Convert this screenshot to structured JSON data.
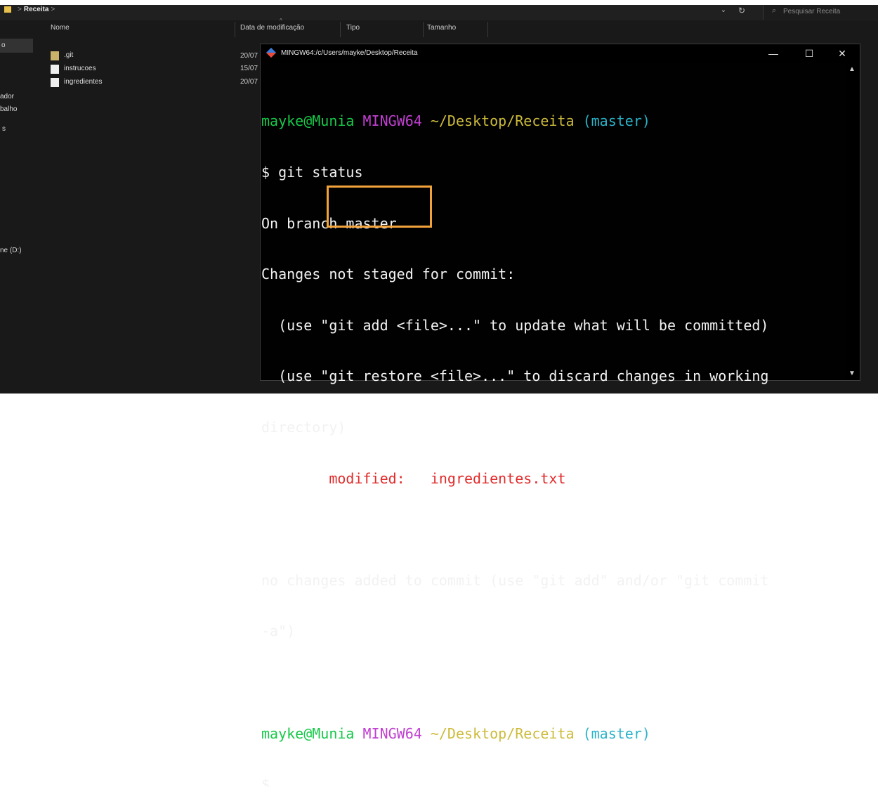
{
  "explorer": {
    "breadcrumb": {
      "sep": ">",
      "folder": "Receita",
      "trailing": ">"
    },
    "search_placeholder": "Pesquisar Receita",
    "columns": {
      "name": "Nome",
      "date": "Data de modificação",
      "type": "Tipo",
      "size": "Tamanho"
    },
    "nav_items": [
      "o",
      "ador",
      "balho",
      "s",
      "ne (D:)"
    ],
    "files": [
      {
        "name": ".git",
        "date": "20/07",
        "kind": "folder"
      },
      {
        "name": "instrucoes",
        "date": "15/07",
        "kind": "doc"
      },
      {
        "name": "ingredientes",
        "date": "20/07",
        "kind": "doc"
      }
    ]
  },
  "terminal": {
    "title": "MINGW64:/c/Users/mayke/Desktop/Receita",
    "controls": {
      "minimize": "—",
      "maximize": "☐",
      "close": "✕"
    },
    "prompt": {
      "user": "mayke@Munia",
      "env": "MINGW64",
      "path": "~/Desktop/Receita",
      "branch": "(master)"
    },
    "command": "$ git status",
    "lines": [
      "On branch master",
      "Changes not staged for commit:",
      "  (use \"git add <file>...\" to update what will be committed)",
      "  (use \"git restore <file>...\" to discard changes in working",
      "directory)"
    ],
    "modified_label": "modified:",
    "modified_file": "ingredientes.txt",
    "footer_lines": [
      "no changes added to commit (use \"git add\" and/or \"git commit",
      "-a\")"
    ],
    "final_prompt": "$"
  },
  "colors": {
    "highlight": "#f2a23a",
    "green": "#17c94a",
    "purple": "#c03fd1",
    "yellow": "#cdbb3b",
    "cyan": "#2bb3c9",
    "red": "#e12b2b"
  },
  "icons": {
    "app": "git-bash-icon",
    "search": "search-icon",
    "refresh": "refresh-icon"
  }
}
